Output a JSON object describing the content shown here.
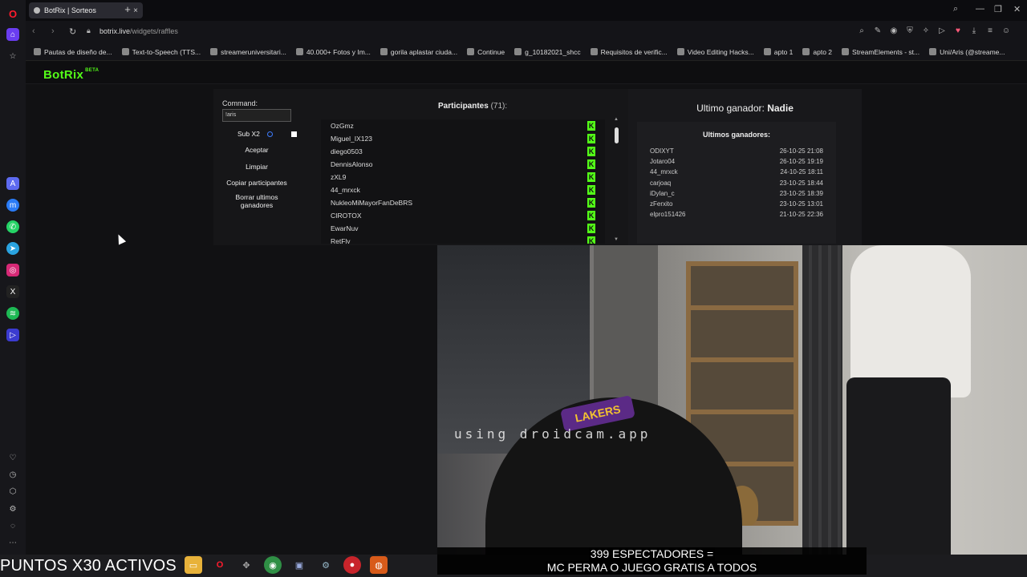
{
  "browser": {
    "tab_title": "BotRix | Sorteos",
    "tab_close": "×",
    "new_tab": "+",
    "url_domain": "botrix.live",
    "url_path": "/widgets/raffles"
  },
  "bookmarks": [
    "Pautas de diseño de...",
    "Text-to-Speech (TTS...",
    "streameruniversitari...",
    "40.000+ Fotos y Im...",
    "gorila aplastar ciuda...",
    "Continue",
    "g_10182021_shcc",
    "Requisitos de verific...",
    "Video Editing Hacks...",
    "apto 1",
    "apto 2",
    "StreamElements - st...",
    "Uni/Aris (@streame..."
  ],
  "botrix": {
    "logo": "BotRix",
    "logo_badge": "BETA",
    "command_label": "Command:",
    "command_value": "!aris",
    "sub_label": "Sub X2",
    "accept_label": "Aceptar",
    "clear_label": "Limpiar",
    "copy_label": "Copiar participantes",
    "delete_line1": "Borrar ultimos",
    "delete_line2": "ganadores",
    "participants_label": "Participantes",
    "participants_count": "(71):",
    "participants": [
      "OzGmz",
      "Miguel_IX123",
      "diego0503",
      "DennisAlonso",
      "zXL9",
      "44_mrxck",
      "NukleoMiMayorFanDeBRS",
      "CIROTOX",
      "EwarNuv",
      "RetFly"
    ],
    "winner_label": "Ultimo ganador:",
    "winner_name": "Nadie",
    "last_winners_label": "Ultimos ganadores:",
    "last_winners": [
      {
        "name": "ODIXYT",
        "date": "26-10-25 21:08"
      },
      {
        "name": "Jotaro04",
        "date": "26-10-25 19:19"
      },
      {
        "name": "44_mrxck",
        "date": "24-10-25 18:11"
      },
      {
        "name": "carjoaq",
        "date": "23-10-25 18:44"
      },
      {
        "name": "iDylan_c",
        "date": "23-10-25 18:39"
      },
      {
        "name": "zFerxito",
        "date": "23-10-25 13:01"
      },
      {
        "name": "elpro151426",
        "date": "21-10-25 22:36"
      }
    ]
  },
  "stream": {
    "watermark": "using droidcam.app",
    "cap_text": "LAKERS",
    "ticker": "PUNTOS X30 ACTIVOS",
    "caption_line1": "399 ESPECTADORES =",
    "caption_line2": "MC PERMA O JUEGO GRATIS A TODOS"
  },
  "colors": {
    "accent": "#53fc18",
    "opera": "#ff1b2d"
  }
}
